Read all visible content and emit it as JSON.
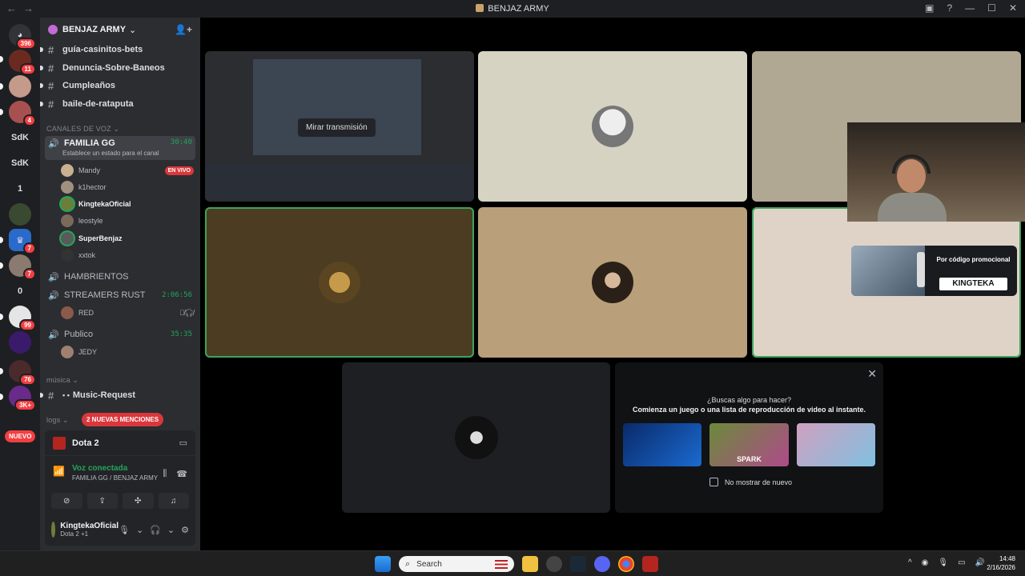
{
  "titlebar": {
    "title": "BENJAZ ARMY"
  },
  "guilds": {
    "badges": [
      "396",
      "11",
      "4",
      "7",
      "7",
      "99",
      "76",
      "3K+"
    ],
    "labels": [
      "SdK",
      "SdK",
      "1",
      "0"
    ],
    "nuevo": "NUEVO"
  },
  "server": {
    "name": "BENJAZ ARMY"
  },
  "channels": [
    "guía-casinitos-bets",
    "Denuncia-Sobre-Baneos",
    "Cumpleaños",
    "baile-de-rataputa"
  ],
  "voice_category": "CANALES DE VOZ",
  "voice_active": {
    "name": "FAMILIA GG",
    "timer": "30:40",
    "status": "Establece un estado para el canal"
  },
  "voice_users": [
    "Mandy",
    "k1hector",
    "KingtekaOficial",
    "leostyle",
    "SuperBenjaz",
    "xxtok"
  ],
  "live_badge": "EN VIVO",
  "voice_channels": [
    {
      "name": "HAMBRIENTOS",
      "timer": ""
    },
    {
      "name": "STREAMERS RUST",
      "timer": "2:06:56"
    },
    {
      "name": "Publico",
      "timer": "35:35"
    }
  ],
  "rust_user": "RED",
  "publico_user": "JEDY",
  "music_category": "música",
  "music_channel": "Music-Request",
  "logs_category": "logs",
  "mentions": "2 NUEVAS MENCIONES",
  "panel": {
    "game": "Dota 2",
    "voice_status": "Voz conectada",
    "voice_location": "FAMILIA GG / BENJAZ ARMY",
    "username": "KingtekaOficial",
    "user_status": "Dota 2 +1"
  },
  "stage": {
    "watch_label": "Mirar transmisión",
    "promo_text": "Por código promocional",
    "promo_code": "KINGTEKA"
  },
  "activity": {
    "question": "¿Buscas algo para hacer?",
    "desc": "Comienza un juego o una lista de reproducción de video al instante.",
    "cards": [
      "",
      "SPARK",
      ""
    ],
    "no_show": "No mostrar de nuevo"
  },
  "taskbar": {
    "search_placeholder": "Search",
    "time": "14:48",
    "date": "2/16/2026"
  }
}
